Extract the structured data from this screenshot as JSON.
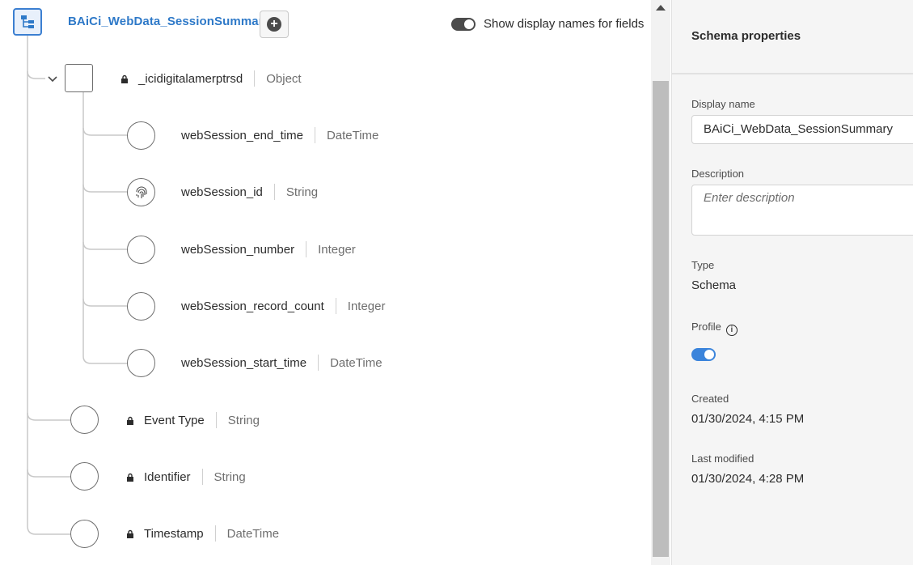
{
  "schema": {
    "title": "BAiCi_WebData_SessionSummary",
    "show_display_names_label": "Show display names for fields",
    "object_field": {
      "name": "_icidigitalamerptrsd",
      "type": "Object"
    },
    "sub_fields": [
      {
        "name": "webSession_end_time",
        "type": "DateTime"
      },
      {
        "name": "webSession_id",
        "type": "String"
      },
      {
        "name": "webSession_number",
        "type": "Integer"
      },
      {
        "name": "webSession_record_count",
        "type": "Integer"
      },
      {
        "name": "webSession_start_time",
        "type": "DateTime"
      }
    ],
    "root_fields": [
      {
        "name": "Event Type",
        "type": "String"
      },
      {
        "name": "Identifier",
        "type": "String"
      },
      {
        "name": "Timestamp",
        "type": "DateTime"
      }
    ]
  },
  "panel": {
    "title": "Schema properties",
    "display_name_label": "Display name",
    "display_name_value": "BAiCi_WebData_SessionSummary",
    "description_label": "Description",
    "description_placeholder": "Enter description",
    "type_label": "Type",
    "type_value": "Schema",
    "profile_label": "Profile",
    "profile_enabled": true,
    "created_label": "Created",
    "created_value": "01/30/2024, 4:15 PM",
    "modified_label": "Last modified",
    "modified_value": "01/30/2024, 4:28 PM"
  },
  "colors": {
    "accent": "#2e79c8",
    "toggle_on": "#3b84db",
    "toggle_dark": "#4b4b4b"
  }
}
